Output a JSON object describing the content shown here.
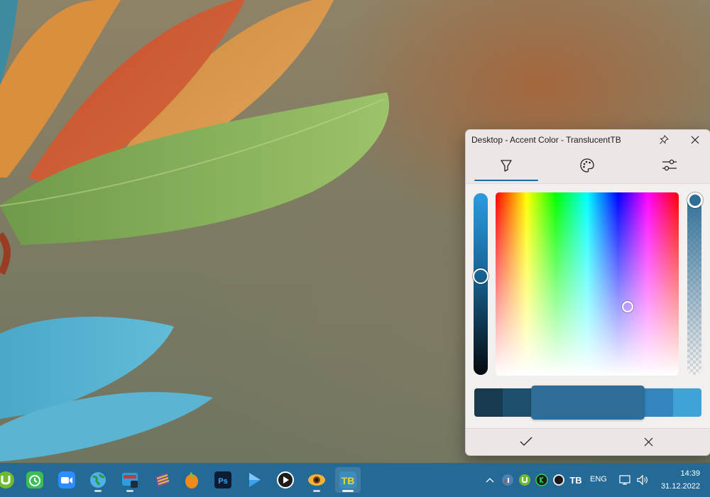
{
  "window": {
    "title": "Desktop - Accent Color - TranslucentTB"
  },
  "tabs": [
    {
      "icon": "pen-icon",
      "selected": true
    },
    {
      "icon": "palette-icon",
      "selected": false
    },
    {
      "icon": "sliders-icon",
      "selected": false
    }
  ],
  "colors": {
    "accent_tab_indicator": "#1e6aa5",
    "swatches": [
      "#183a4f",
      "#1f4f6e",
      "#2e6e96",
      "#3286bd",
      "#41a2d8"
    ],
    "selected_swatch": "#2e6e96"
  },
  "taskbar": {
    "apps": [
      "utorrent-icon",
      "alarm-clock-icon",
      "zoom-icon",
      "globe-icon",
      "media-app-icon",
      "winrar-icon",
      "fl-studio-icon",
      "photoshop-icon",
      "play-arrow-icon",
      "media-player-icon",
      "eye-app-icon",
      "translucenttb-icon"
    ],
    "photoshop_label": "Ps",
    "translucenttb_label": "TB",
    "tray_tb_label": "TB",
    "language": "ENG",
    "time": "14:39",
    "date": "31.12.2022"
  }
}
